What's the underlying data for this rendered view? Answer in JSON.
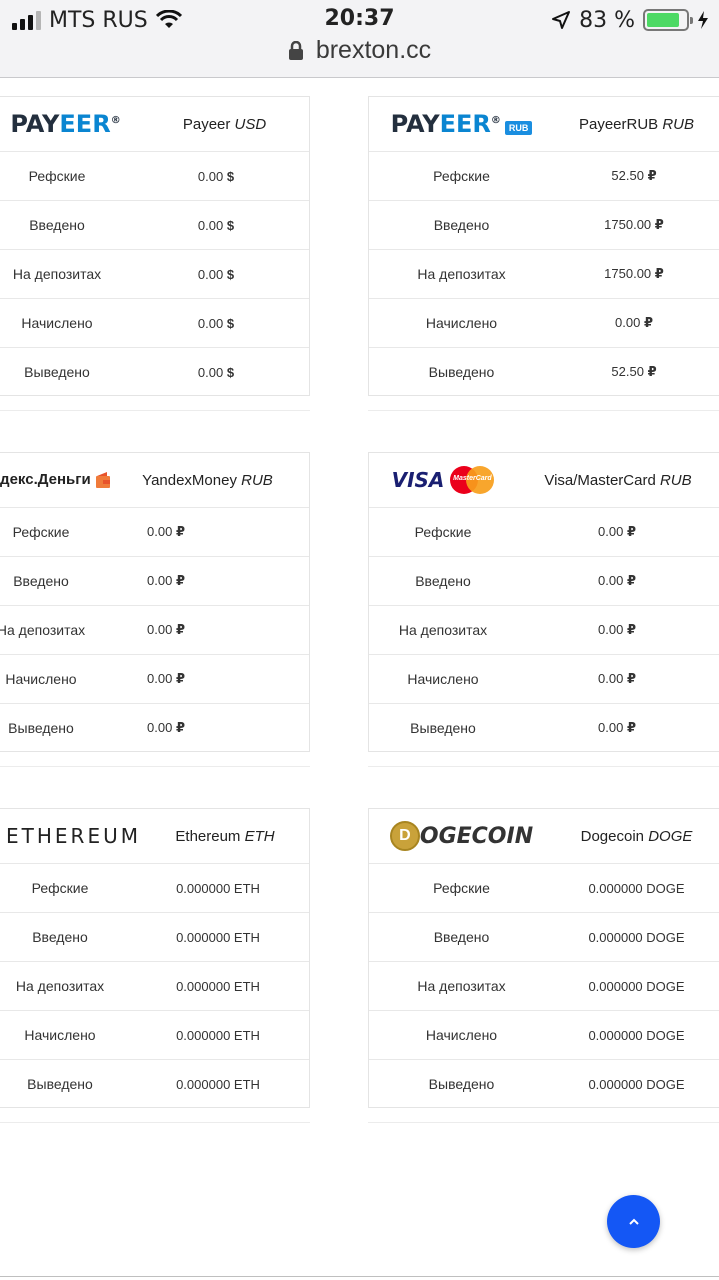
{
  "status_bar": {
    "carrier": "MTS RUS",
    "time": "20:37",
    "battery": "83 %",
    "battery_level": 0.83
  },
  "browser": {
    "url": "brexton.cc"
  },
  "colors": {
    "accent": "#1457f5",
    "payeer_blue": "#0a85d1",
    "battery_green": "#4cd964"
  },
  "row_labels": [
    "Рефские",
    "Введено",
    "На депозитах",
    "Начислено",
    "Выведено"
  ],
  "cards": [
    {
      "logo": {
        "text_a": "PAY",
        "text_b": "EER",
        "mark": "®"
      },
      "name": "Payeer",
      "currency": "USD",
      "values": [
        "0.00",
        "0.00",
        "0.00",
        "0.00",
        "0.00"
      ],
      "symbol": "$"
    },
    {
      "logo": {
        "text_a": "PAY",
        "text_b": "EER",
        "mark": "®",
        "badge": "RUB"
      },
      "name": "PayeerRUB",
      "currency": "RUB",
      "values": [
        "52.50",
        "1750.00",
        "1750.00",
        "0.00",
        "52.50"
      ],
      "symbol": "₽"
    },
    {
      "logo": {
        "text_a": "ндекс.Деньги"
      },
      "name": "YandexMoney",
      "currency": "RUB",
      "values": [
        "0.00",
        "0.00",
        "0.00",
        "0.00",
        "0.00"
      ],
      "symbol": "₽"
    },
    {
      "logo": {
        "visa": "VISA",
        "mastercard": "MasterCard"
      },
      "name": "Visa/MasterCard",
      "currency": "RUB",
      "values": [
        "0.00",
        "0.00",
        "0.00",
        "0.00",
        "0.00"
      ],
      "symbol": "₽"
    },
    {
      "logo": {
        "text_a": "ETHEREUM"
      },
      "name": "Ethereum",
      "currency": "ETH",
      "values": [
        "0.000000 ETH",
        "0.000000 ETH",
        "0.000000 ETH",
        "0.000000 ETH",
        "0.000000 ETH"
      ],
      "symbol": ""
    },
    {
      "logo": {
        "text_a": "OGECOIN",
        "coin_letter": "D"
      },
      "name": "Dogecoin",
      "currency": "DOGE",
      "values": [
        "0.000000 DOGE",
        "0.000000 DOGE",
        "0.000000 DOGE",
        "0.000000 DOGE",
        "0.000000 DOGE"
      ],
      "symbol": ""
    }
  ]
}
